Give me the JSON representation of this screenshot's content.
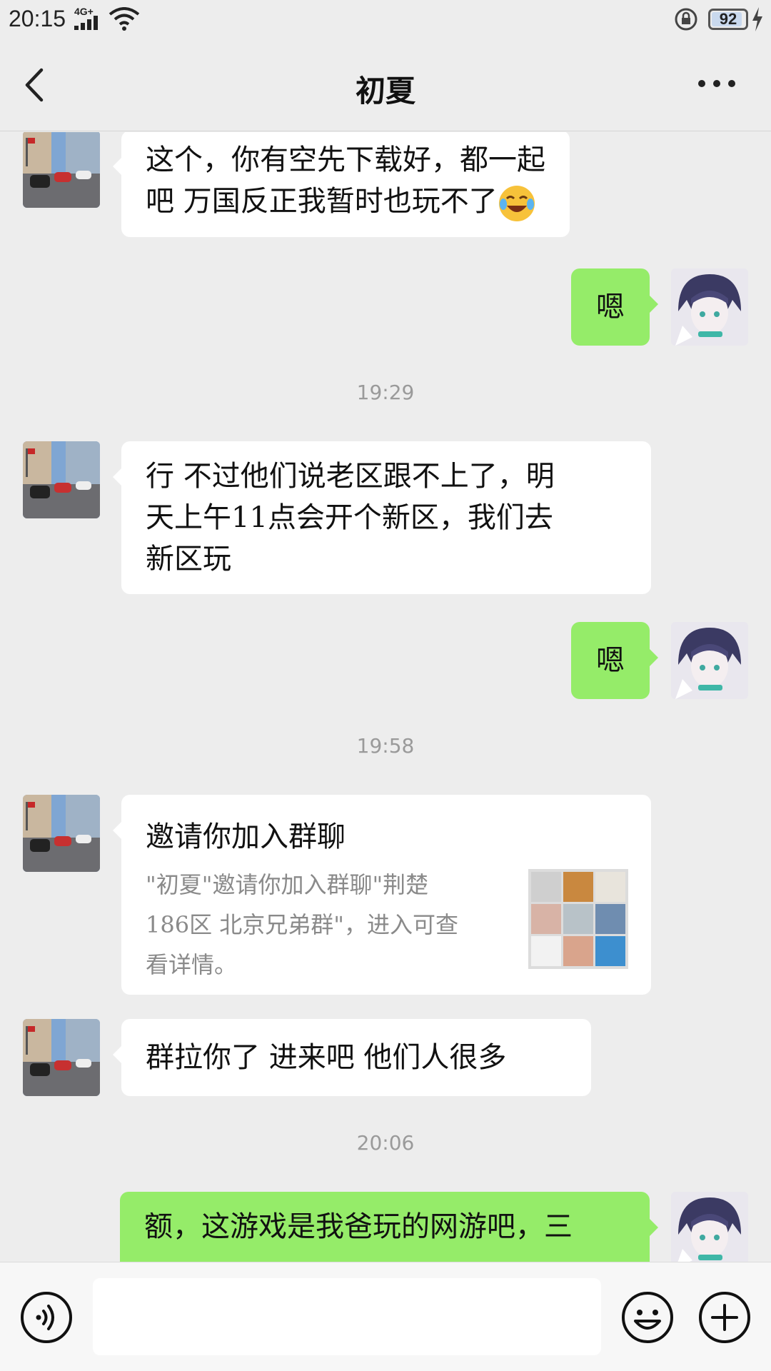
{
  "status": {
    "time": "20:15",
    "network": "4G+",
    "battery_level": "92",
    "battery_fraction": 0.92
  },
  "nav": {
    "title": "初夏",
    "back_icon": "chevron-left-icon",
    "more_icon": "more-dots-icon"
  },
  "colors": {
    "background": "#ededed",
    "bubble_self": "#95ec69",
    "bubble_other": "#ffffff",
    "timestamp": "#9a9a9a"
  },
  "messages": [
    {
      "sender": "other",
      "lines": [
        "这个，你有空先下载好，都一起",
        "吧 万国反正我暂时也玩不了"
      ],
      "emoji": "tears-of-joy-emoji"
    },
    {
      "sender": "self",
      "text": "嗯"
    },
    {
      "type": "time",
      "text": "19:29"
    },
    {
      "sender": "other",
      "lines": [
        "行 不过他们说老区跟不上了，明",
        "天上午11点会开个新区，我们去",
        "新区玩"
      ]
    },
    {
      "sender": "self",
      "text": "嗯"
    },
    {
      "type": "time",
      "text": "19:58"
    },
    {
      "sender": "other",
      "type": "invite",
      "title": "邀请你加入群聊",
      "desc_lines": [
        "\"初夏\"邀请你加入群聊\"荆楚",
        "186区 北京兄弟群\"，进入可查",
        "看详情。"
      ]
    },
    {
      "sender": "other",
      "text": "群拉你了 进来吧 他们人很多"
    },
    {
      "type": "time",
      "text": "20:06"
    },
    {
      "sender": "self",
      "lines": [
        "额，这游戏是我爸玩的网游吧，三"
      ]
    }
  ],
  "input_bar": {
    "placeholder": "",
    "voice_icon": "voice-icon",
    "emoji_icon": "emoji-icon",
    "plus_icon": "plus-icon"
  }
}
